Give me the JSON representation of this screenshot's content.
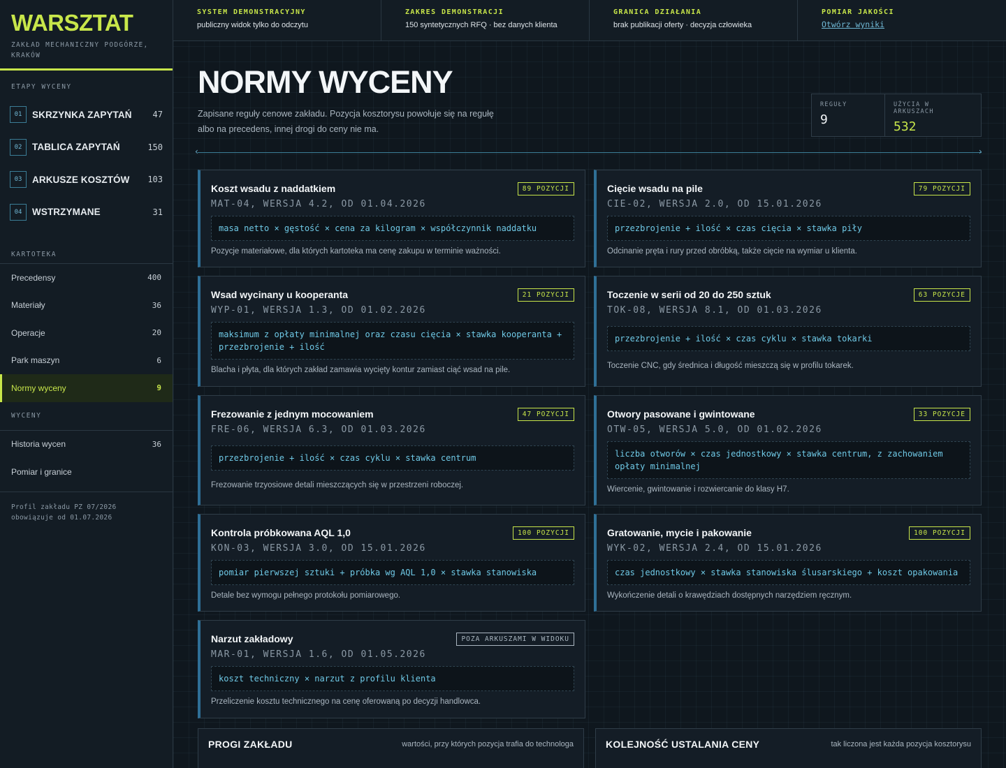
{
  "brand": {
    "logo": "WARSZTAT",
    "subtitle": "ZAKŁAD MECHANICZNY PODGÓRZE, KRAKÓW"
  },
  "sidebar": {
    "stages_heading": "ETAPY WYCENY",
    "stages": [
      {
        "num": "01",
        "label": "SKRZYNKA ZAPYTAŃ",
        "count": "47"
      },
      {
        "num": "02",
        "label": "TABLICA ZAPYTAŃ",
        "count": "150"
      },
      {
        "num": "03",
        "label": "ARKUSZE KOSZTÓW",
        "count": "103"
      },
      {
        "num": "04",
        "label": "WSTRZYMANE",
        "count": "31"
      }
    ],
    "kartoteka_heading": "KARTOTEKA",
    "kartoteka": [
      {
        "label": "Precedensy",
        "count": "400"
      },
      {
        "label": "Materiały",
        "count": "36"
      },
      {
        "label": "Operacje",
        "count": "20"
      },
      {
        "label": "Park maszyn",
        "count": "6"
      },
      {
        "label": "Normy wyceny",
        "count": "9",
        "active": true
      }
    ],
    "wyceny_heading": "WYCENY",
    "wyceny": [
      {
        "label": "Historia wycen",
        "count": "36"
      },
      {
        "label": "Pomiar i granice",
        "count": ""
      }
    ],
    "profile_line1": "Profil zakładu PZ 07/2026",
    "profile_line2": "obowiązuje od 01.07.2026"
  },
  "topbar": [
    {
      "title": "SYSTEM DEMONSTRACYJNY",
      "text": "publiczny widok tylko do odczytu"
    },
    {
      "title": "ZAKRES DEMONSTRACJI",
      "text": "150 syntetycznych RFQ · bez danych klienta"
    },
    {
      "title": "GRANICA DZIAŁANIA",
      "text": "brak publikacji oferty · decyzja człowieka"
    },
    {
      "title": "POMIAR JAKOŚCI",
      "link": "Otwórz wyniki"
    }
  ],
  "page": {
    "title": "NORMY WYCENY",
    "description": "Zapisane reguły cenowe zakładu. Pozycja kosztorysu powołuje się na regułę albo na precedens, innej drogi do ceny nie ma."
  },
  "stats": {
    "rules_label": "REGUŁY",
    "rules_value": "9",
    "usage_label": "UŻYCIA W ARKUSZACH",
    "usage_value": "532"
  },
  "rules": [
    {
      "title": "Koszt wsadu z naddatkiem",
      "badge": "89 POZYCJI",
      "code": "MAT-04, WERSJA 4.2, OD 01.04.2026",
      "formula": "masa netto × gęstość × cena za kilogram × współczynnik naddatku",
      "desc": "Pozycje materiałowe, dla których kartoteka ma cenę zakupu w terminie ważności."
    },
    {
      "title": "Cięcie wsadu na pile",
      "badge": "79 POZYCJI",
      "code": "CIE-02, WERSJA 2.0, OD 15.01.2026",
      "formula": "przezbrojenie + ilość × czas cięcia × stawka piły",
      "desc": "Odcinanie pręta i rury przed obróbką, także cięcie na wymiar u klienta."
    },
    {
      "title": "Wsad wycinany u kooperanta",
      "badge": "21 POZYCJI",
      "code": "WYP-01, WERSJA 1.3, OD 01.02.2026",
      "formula": "maksimum z opłaty minimalnej oraz czasu cięcia × stawka kooperanta + przezbrojenie + ilość",
      "desc": "Blacha i płyta, dla których zakład zamawia wycięty kontur zamiast ciąć wsad na pile."
    },
    {
      "title": "Toczenie w serii od 20 do 250 sztuk",
      "badge": "63 POZYCJE",
      "code": "TOK-08, WERSJA 8.1, OD 01.03.2026",
      "formula": "przezbrojenie + ilość × czas cyklu × stawka tokarki",
      "desc": "Toczenie CNC, gdy średnica i długość mieszczą się w profilu tokarek."
    },
    {
      "title": "Frezowanie z jednym mocowaniem",
      "badge": "47 POZYCJI",
      "code": "FRE-06, WERSJA 6.3, OD 01.03.2026",
      "formula": "przezbrojenie + ilość × czas cyklu × stawka centrum",
      "desc": "Frezowanie trzyosiowe detali mieszczących się w przestrzeni roboczej."
    },
    {
      "title": "Otwory pasowane i gwintowane",
      "badge": "33 POZYCJE",
      "code": "OTW-05, WERSJA 5.0, OD 01.02.2026",
      "formula": "liczba otworów × czas jednostkowy × stawka centrum, z zachowaniem opłaty minimalnej",
      "desc": "Wiercenie, gwintowanie i rozwiercanie do klasy H7."
    },
    {
      "title": "Kontrola próbkowana AQL 1,0",
      "badge": "100 POZYCJI",
      "code": "KON-03, WERSJA 3.0, OD 15.01.2026",
      "formula": "pomiar pierwszej sztuki + próbka wg AQL 1,0 × stawka stanowiska",
      "desc": "Detale bez wymogu pełnego protokołu pomiarowego."
    },
    {
      "title": "Gratowanie, mycie i pakowanie",
      "badge": "100 POZYCJI",
      "code": "WYK-02, WERSJA 2.4, OD 15.01.2026",
      "formula": "czas jednostkowy × stawka stanowiska ślusarskiego + koszt opakowania",
      "desc": "Wykończenie detali o krawędziach dostępnych narzędziem ręcznym."
    },
    {
      "title": "Narzut zakładowy",
      "badge": "POZA ARKUSZAMI W WIDOKU",
      "badge_muted": true,
      "code": "MAR-01, WERSJA 1.6, OD 01.05.2026",
      "formula": "koszt techniczny × narzut z profilu klienta",
      "desc": "Przeliczenie kosztu technicznego na cenę oferowaną po decyzji handlowca."
    }
  ],
  "panels": {
    "left_title": "PROGI ZAKŁADU",
    "left_sub": "wartości, przy których pozycja trafia do technologa",
    "right_title": "KOLEJNOŚĆ USTALANIA CENY",
    "right_sub": "tak liczona jest każda pozycja kosztorysu"
  },
  "icons": {
    "scroll_left": "chevron-left-icon",
    "scroll_right": "chevron-right-icon"
  },
  "colors": {
    "accent": "#c8e64a",
    "link": "#6fb7d4",
    "formula": "#6fc9e6",
    "card_border": "#2f6f96"
  }
}
